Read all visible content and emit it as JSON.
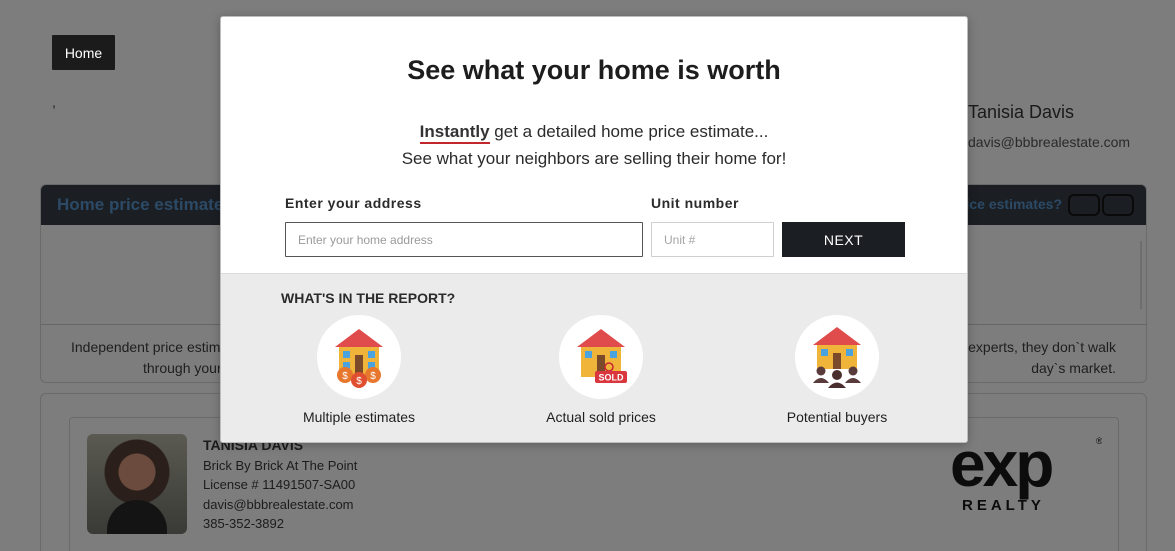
{
  "nav": {
    "home_label": "Home"
  },
  "page": {
    "comma": ","
  },
  "agent_top": {
    "name": "Tanisia Davis",
    "email": "davis@bbbrealestate.com"
  },
  "estimate": {
    "header_title": "Home price estimate",
    "header_right": "rice estimates?",
    "text_left_1": "Independent price estima",
    "text_left_2": "through your",
    "text_right_1": "experts, they don`t walk",
    "text_right_2": "day`s market."
  },
  "agent_card": {
    "name": "TANISIA DAVIS",
    "company": "Brick By Brick At The Point",
    "license": "License # 11491507-SA00",
    "email": "davis@bbbrealestate.com",
    "phone": "385-352-3892",
    "logo_text": "exp",
    "logo_sub": "REALTY"
  },
  "modal": {
    "title": "See what your home is worth",
    "sub_emphasis": "Instantly",
    "sub_line1_rest": " get a detailed home price estimate...",
    "sub_line2": "See what your neighbors are selling their home for!",
    "address_label": "Enter your address",
    "address_placeholder": "Enter your home address",
    "address_value": "",
    "unit_label": "Unit number",
    "unit_placeholder": "Unit #",
    "unit_value": "",
    "next_label": "NEXT"
  },
  "report": {
    "title": "WHAT'S IN THE REPORT?",
    "features": [
      {
        "label": "Multiple estimates",
        "icon": "house-coins-icon"
      },
      {
        "label": "Actual sold prices",
        "icon": "house-sold-icon",
        "badge": "SOLD"
      },
      {
        "label": "Potential buyers",
        "icon": "house-people-icon"
      }
    ]
  },
  "colors": {
    "modal_bg": "#ffffff",
    "overlay": "#7d7d7d",
    "next_bg": "#1b1f24",
    "accent_underline": "#c2272d",
    "report_bg": "#ebebeb"
  }
}
